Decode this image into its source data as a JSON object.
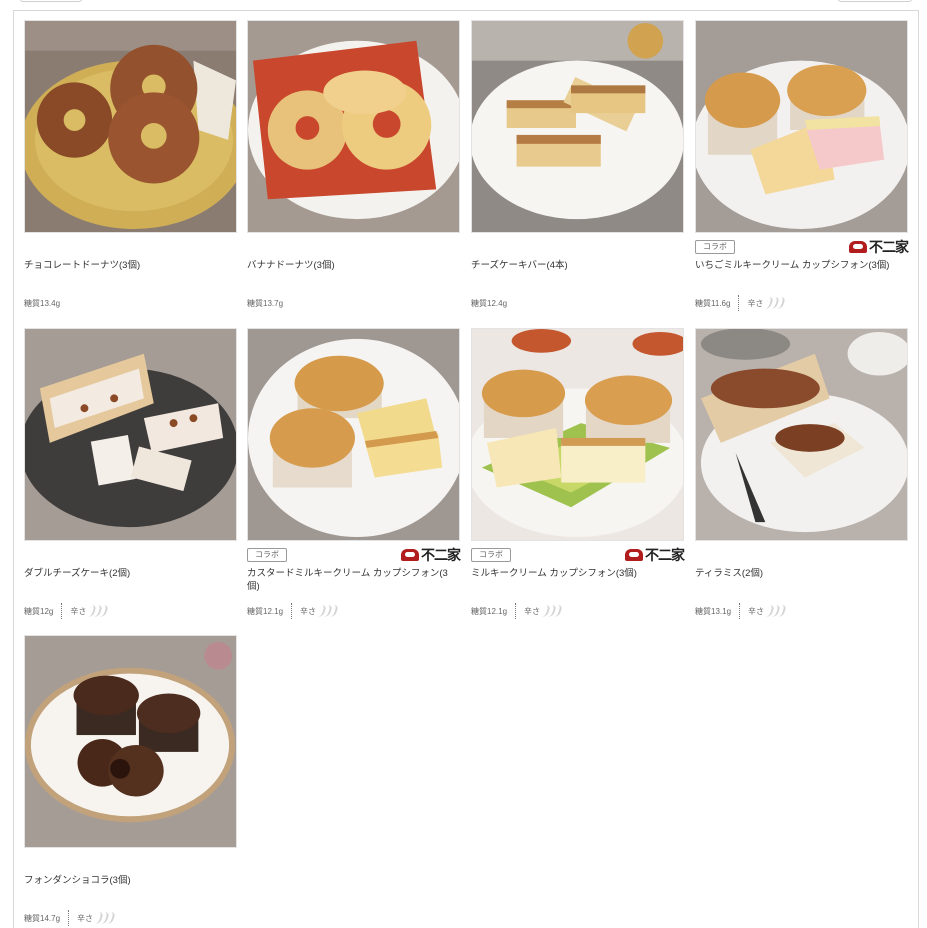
{
  "labels": {
    "sugar_prefix": "糖質",
    "spicy_label": "辛さ",
    "collab_badge": "コラボ",
    "brand_logo_text": "不二家"
  },
  "products": [
    {
      "name": "チョコレートドーナツ(3個)",
      "sugar": "13.4g",
      "collab": false,
      "spicy": false
    },
    {
      "name": "バナナドーナツ(3個)",
      "sugar": "13.7g",
      "collab": false,
      "spicy": false
    },
    {
      "name": "チーズケーキバー(4本)",
      "sugar": "12.4g",
      "collab": false,
      "spicy": false
    },
    {
      "name": "いちごミルキークリーム カップシフォン(3個)",
      "sugar": "11.6g",
      "collab": true,
      "spicy": true
    },
    {
      "name": "ダブルチーズケーキ(2個)",
      "sugar": "12g",
      "collab": false,
      "spicy": true
    },
    {
      "name": "カスタードミルキークリーム カップシフォン(3個)",
      "sugar": "12.1g",
      "collab": true,
      "spicy": true
    },
    {
      "name": "ミルキークリーム カップシフォン(3個)",
      "sugar": "12.1g",
      "collab": true,
      "spicy": true
    },
    {
      "name": "ティラミス(2個)",
      "sugar": "13.1g",
      "collab": false,
      "spicy": true
    },
    {
      "name": "フォンダンショコラ(3個)",
      "sugar": "14.7g",
      "collab": false,
      "spicy": true
    }
  ],
  "colors": {
    "border": "#d8d8d8",
    "text": "#333333",
    "muted": "#666666",
    "chili": "#d3d3d3",
    "logo_red": "#b11c1c"
  }
}
